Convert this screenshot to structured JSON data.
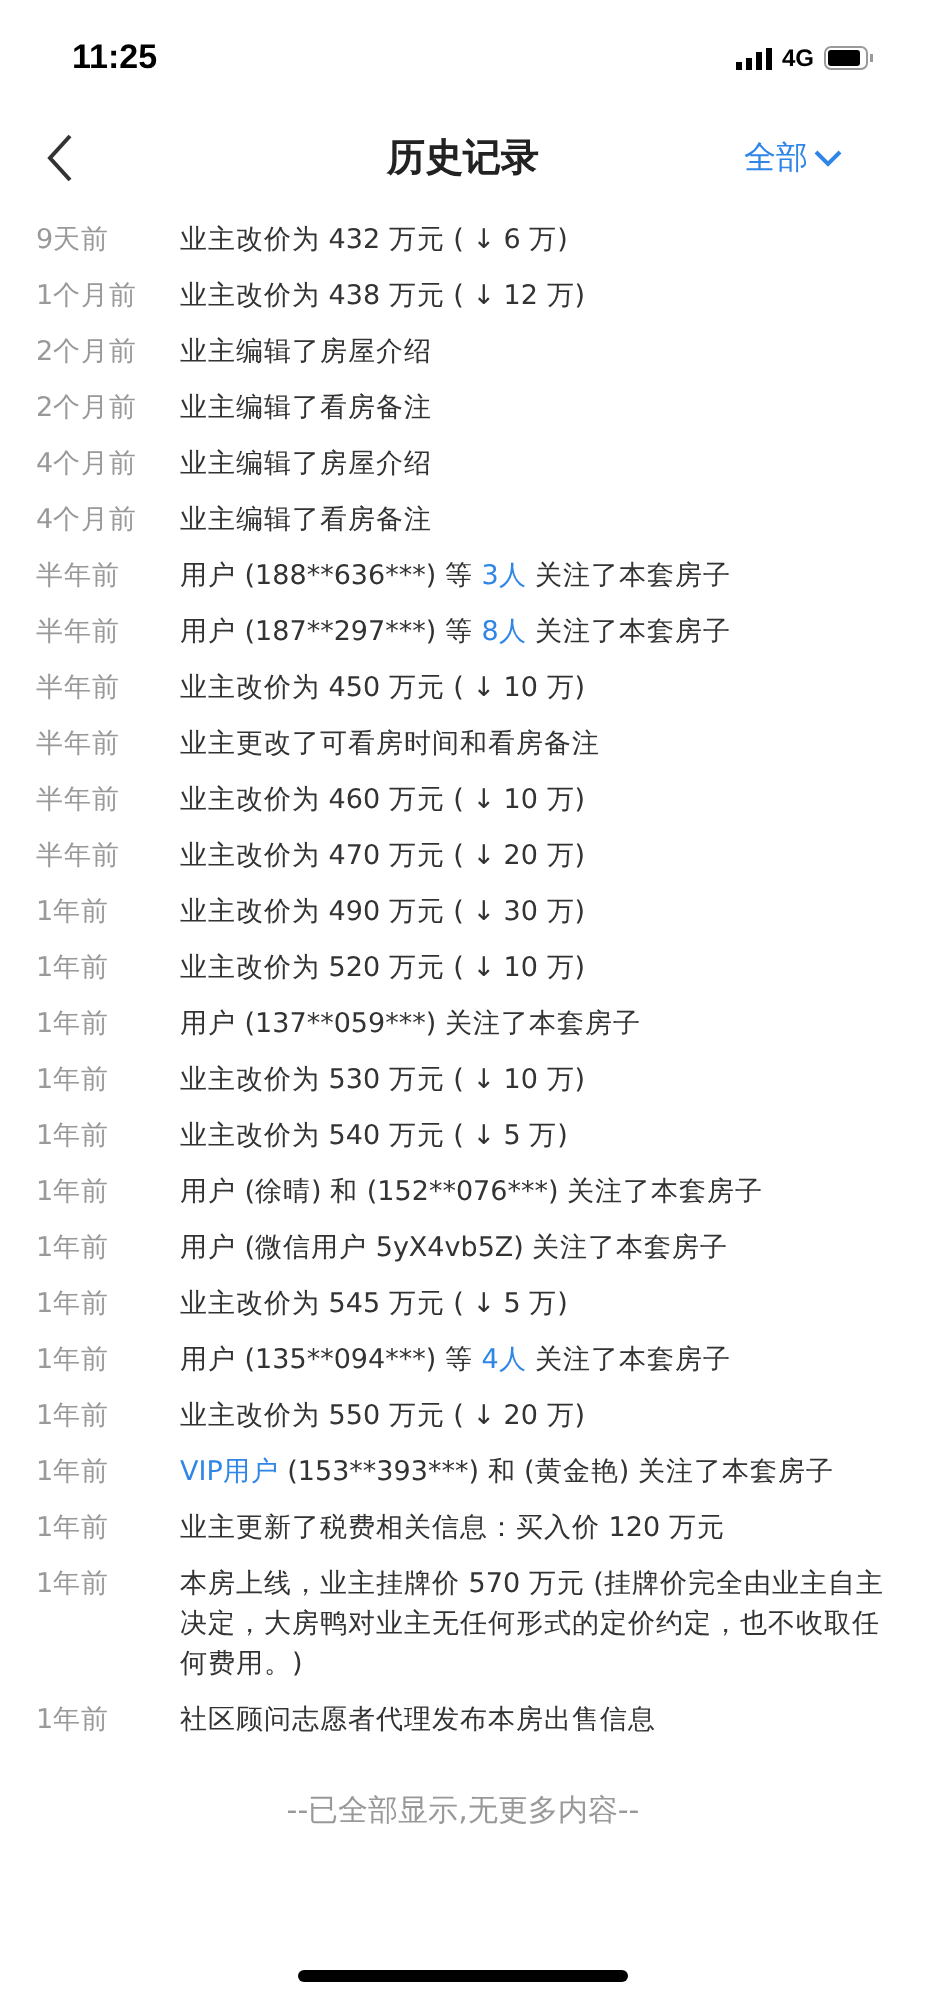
{
  "status_bar": {
    "time": "11:25",
    "network": "4G"
  },
  "nav": {
    "title": "历史记录",
    "filter": "全部"
  },
  "records": [
    {
      "time": "9天前",
      "parts": [
        {
          "text": "业主改价为 432 万元 ( ↓ 6 万)",
          "link": false
        }
      ]
    },
    {
      "time": "1个月前",
      "parts": [
        {
          "text": "业主改价为 438 万元 ( ↓ 12 万)",
          "link": false
        }
      ]
    },
    {
      "time": "2个月前",
      "parts": [
        {
          "text": "业主编辑了房屋介绍",
          "link": false
        }
      ]
    },
    {
      "time": "2个月前",
      "parts": [
        {
          "text": "业主编辑了看房备注",
          "link": false
        }
      ]
    },
    {
      "time": "4个月前",
      "parts": [
        {
          "text": "业主编辑了房屋介绍",
          "link": false
        }
      ]
    },
    {
      "time": "4个月前",
      "parts": [
        {
          "text": "业主编辑了看房备注",
          "link": false
        }
      ]
    },
    {
      "time": "半年前",
      "parts": [
        {
          "text": "用户 (188**636***) 等 ",
          "link": false
        },
        {
          "text": "3人",
          "link": true
        },
        {
          "text": " 关注了本套房子",
          "link": false
        }
      ]
    },
    {
      "time": "半年前",
      "parts": [
        {
          "text": "用户 (187**297***) 等 ",
          "link": false
        },
        {
          "text": "8人",
          "link": true
        },
        {
          "text": " 关注了本套房子",
          "link": false
        }
      ]
    },
    {
      "time": "半年前",
      "parts": [
        {
          "text": "业主改价为 450 万元 ( ↓ 10 万)",
          "link": false
        }
      ]
    },
    {
      "time": "半年前",
      "parts": [
        {
          "text": "业主更改了可看房时间和看房备注",
          "link": false
        }
      ]
    },
    {
      "time": "半年前",
      "parts": [
        {
          "text": "业主改价为 460 万元 ( ↓ 10 万)",
          "link": false
        }
      ]
    },
    {
      "time": "半年前",
      "parts": [
        {
          "text": "业主改价为 470 万元 ( ↓ 20 万)",
          "link": false
        }
      ]
    },
    {
      "time": "1年前",
      "parts": [
        {
          "text": "业主改价为 490 万元 ( ↓ 30 万)",
          "link": false
        }
      ]
    },
    {
      "time": "1年前",
      "parts": [
        {
          "text": "业主改价为 520 万元 ( ↓ 10 万)",
          "link": false
        }
      ]
    },
    {
      "time": "1年前",
      "parts": [
        {
          "text": "用户 (137**059***) 关注了本套房子",
          "link": false
        }
      ]
    },
    {
      "time": "1年前",
      "parts": [
        {
          "text": "业主改价为 530 万元 ( ↓ 10 万)",
          "link": false
        }
      ]
    },
    {
      "time": "1年前",
      "parts": [
        {
          "text": "业主改价为 540 万元 ( ↓ 5 万)",
          "link": false
        }
      ]
    },
    {
      "time": "1年前",
      "parts": [
        {
          "text": "用户 (徐晴) 和 (152**076***) 关注了本套房子",
          "link": false
        }
      ]
    },
    {
      "time": "1年前",
      "parts": [
        {
          "text": "用户 (微信用户 5yX4vb5Z) 关注了本套房子",
          "link": false
        }
      ]
    },
    {
      "time": "1年前",
      "parts": [
        {
          "text": "业主改价为 545 万元 ( ↓ 5 万)",
          "link": false
        }
      ]
    },
    {
      "time": "1年前",
      "parts": [
        {
          "text": "用户 (135**094***) 等 ",
          "link": false
        },
        {
          "text": "4人",
          "link": true
        },
        {
          "text": " 关注了本套房子",
          "link": false
        }
      ]
    },
    {
      "time": "1年前",
      "parts": [
        {
          "text": "业主改价为 550 万元 ( ↓ 20 万)",
          "link": false
        }
      ]
    },
    {
      "time": "1年前",
      "parts": [
        {
          "text": "VIP用户",
          "link": true
        },
        {
          "text": " (153**393***) 和 (黄金艳) 关注了本套房子",
          "link": false
        }
      ]
    },
    {
      "time": "1年前",
      "parts": [
        {
          "text": "业主更新了税费相关信息：买入价 120 万元",
          "link": false
        }
      ]
    },
    {
      "time": "1年前",
      "parts": [
        {
          "text": "本房上线，业主挂牌价 570 万元 (挂牌价完全由业主自主决定，大房鸭对业主无任何形式的定价约定，也不收取任何费用。)",
          "link": false
        }
      ]
    },
    {
      "time": "1年前",
      "parts": [
        {
          "text": "社区顾问志愿者代理发布本房出售信息",
          "link": false
        }
      ]
    }
  ],
  "footer": "--已全部显示,无更多内容--"
}
